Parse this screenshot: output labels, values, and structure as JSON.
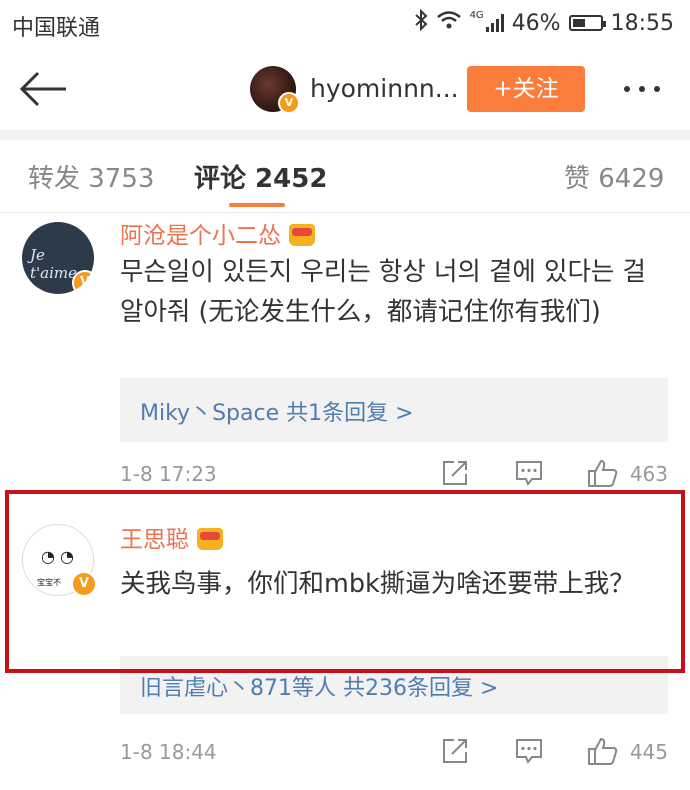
{
  "status_bar": {
    "carrier": "中国联通",
    "network": "4G",
    "battery": "46%",
    "battery_level": 0.46,
    "time": "18:55"
  },
  "nav": {
    "username": "hyominnn...",
    "follow_label": "+关注"
  },
  "tabs": [
    {
      "label": "转发 3753"
    },
    {
      "label": "评论 2452"
    },
    {
      "label": "赞 6429"
    }
  ],
  "comments": [
    {
      "avatar_text": "Je t'aime",
      "username": "阿沧是个小二怂",
      "text": "무슨일이 있든지 우리는 항상 너의 곁에 있다는 걸 알아줘 (无论发生什么，都请记住你有我们)",
      "replies": "Miky丶Space  共1条回复 >",
      "date": "1-8 17:23",
      "likes": "463"
    },
    {
      "avatar_text": "宝宝不",
      "username": "王思聪",
      "text": "关我鸟事，你们和mbk撕逼为啥还要带上我？",
      "replies": "旧言虐心丶871等人  共236条回复 >",
      "date": "1-8 18:44",
      "likes": "445"
    }
  ],
  "colors": {
    "accent": "#fa7d3c",
    "username": "#eb7350",
    "link": "#507daf",
    "highlight": "#c4121b"
  }
}
